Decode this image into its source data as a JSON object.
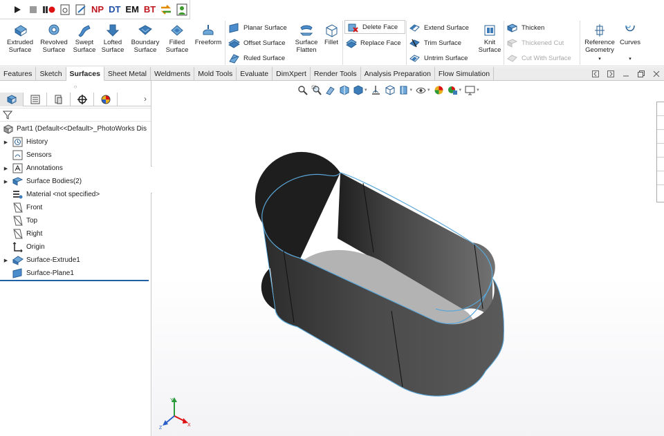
{
  "macro": {
    "np": "NP",
    "dt": "DT",
    "em": "EM",
    "bt": "BT"
  },
  "ribbon": {
    "extruded": [
      "Extruded",
      "Surface"
    ],
    "revolved": [
      "Revolved",
      "Surface"
    ],
    "swept": [
      "Swept",
      "Surface"
    ],
    "lofted": [
      "Lofted",
      "Surface"
    ],
    "boundary": [
      "Boundary",
      "Surface"
    ],
    "filled": [
      "Filled",
      "Surface"
    ],
    "freeform": "Freeform",
    "planar": "Planar Surface",
    "offset": "Offset Surface",
    "ruled": "Ruled Surface",
    "flatten": [
      "Surface",
      "Flatten"
    ],
    "fillet": "Fillet",
    "delete_face": "Delete Face",
    "replace_face": "Replace Face",
    "extend": "Extend Surface",
    "trim": "Trim Surface",
    "untrim": "Untrim Surface",
    "knit": [
      "Knit",
      "Surface"
    ],
    "thicken": "Thicken",
    "thickened_cut": "Thickened Cut",
    "cut_with_surface": "Cut With Surface",
    "reference_geometry": [
      "Reference",
      "Geometry"
    ],
    "curves": "Curves"
  },
  "tabs": [
    "Features",
    "Sketch",
    "Surfaces",
    "Sheet Metal",
    "Weldments",
    "Mold Tools",
    "Evaluate",
    "DimXpert",
    "Render Tools",
    "Analysis Preparation",
    "Flow Simulation"
  ],
  "active_tab": "Surfaces",
  "tree": {
    "root": "Part1  (Default<<Default>_PhotoWorks Dis",
    "items": [
      {
        "label": "History",
        "expandable": true
      },
      {
        "label": "Sensors",
        "expandable": false
      },
      {
        "label": "Annotations",
        "expandable": true
      },
      {
        "label": "Surface Bodies(2)",
        "expandable": true
      },
      {
        "label": "Material <not specified>",
        "expandable": false
      },
      {
        "label": "Front",
        "expandable": false
      },
      {
        "label": "Top",
        "expandable": false
      },
      {
        "label": "Right",
        "expandable": false
      },
      {
        "label": "Origin",
        "expandable": false
      },
      {
        "label": "Surface-Extrude1",
        "expandable": true
      },
      {
        "label": "Surface-Plane1",
        "expandable": false
      }
    ]
  },
  "colors": {
    "accent": "#1f5fa8",
    "edge": "#5aa6d8",
    "surface_dark": "#3c3c3c",
    "surface_light": "#b3b3b3"
  },
  "triad": {
    "x": "X",
    "y": "Y",
    "z": "Z"
  }
}
